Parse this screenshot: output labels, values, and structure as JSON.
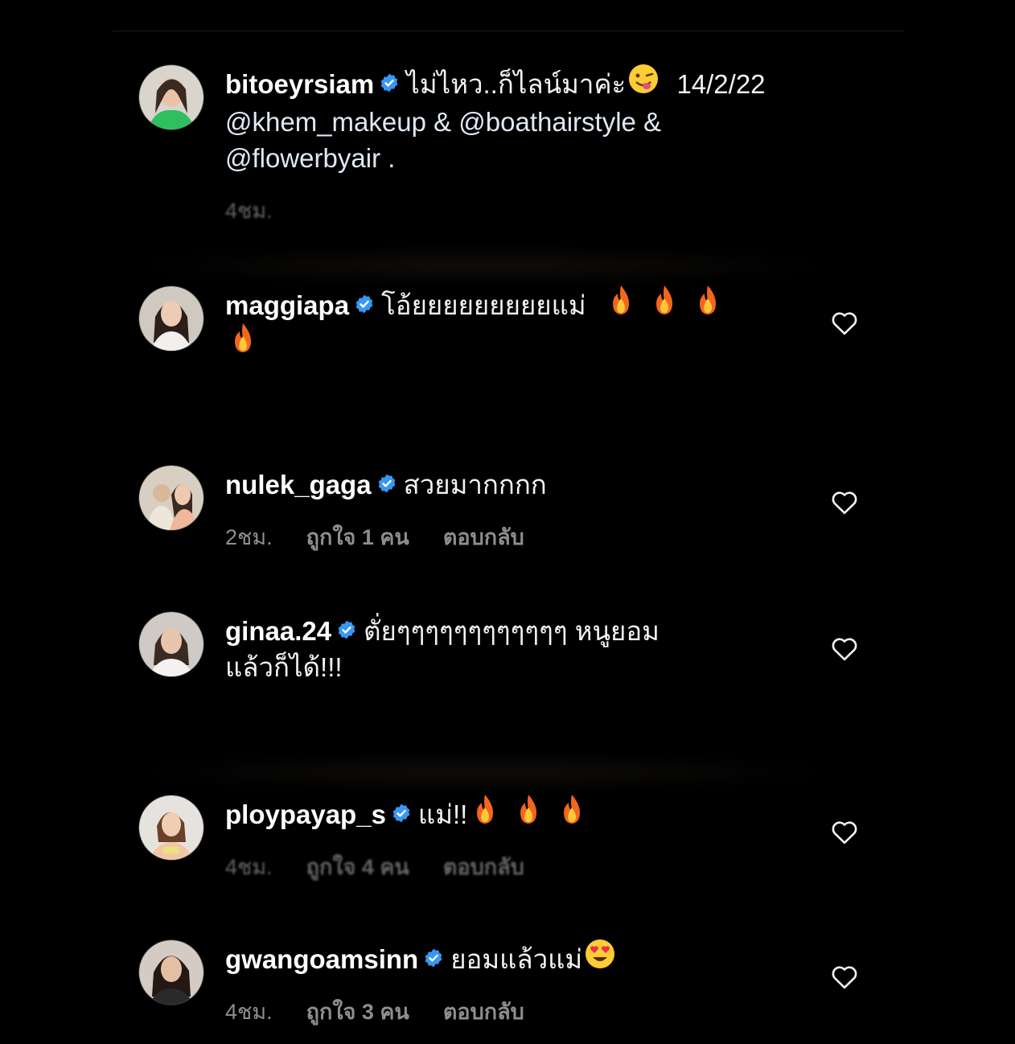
{
  "comments": [
    {
      "username": "bitoeyrsiam",
      "text": "ไม่ไหว..ก็ไลน์มาค่ะ",
      "emoji": "😜",
      "date": "14/2/22",
      "mentions_line1": "@khem_makeup & @boathairstyle &",
      "mentions_line2": "@flowerbyair .",
      "time": "4ชม."
    },
    {
      "username": "maggiapa",
      "text": "โอ้ยยยยยยยยยแม่",
      "emoji": "🔥"
    },
    {
      "username": "nulek_gaga",
      "text": "สวยมากกกก",
      "time": "2ชม.",
      "likes": "ถูกใจ 1 คน",
      "reply": "ตอบกลับ"
    },
    {
      "username": "ginaa.24",
      "text": "ตั่ยๆๆๆๆๆๆๆๆๆๆๆๆ หนูยอม",
      "text_line2": "แล้วก็ได้!!!"
    },
    {
      "username": "ploypayap_s",
      "text": "แม่!!",
      "emoji": "🔥",
      "time": "4ชม.",
      "likes": "ถูกใจ 4 คน",
      "reply": "ตอบกลับ"
    },
    {
      "username": "gwangoamsinn",
      "text": "ยอมแล้วแม่",
      "emoji": "😍",
      "time": "4ชม.",
      "likes": "ถูกใจ 3 คน",
      "reply": "ตอบกลับ"
    }
  ],
  "colors": {
    "background": "#000000",
    "verified": "#3897f0",
    "meta_text": "#8e8e8e"
  },
  "icons": {
    "verified": "verified-badge-icon",
    "like": "heart-outline-icon"
  }
}
